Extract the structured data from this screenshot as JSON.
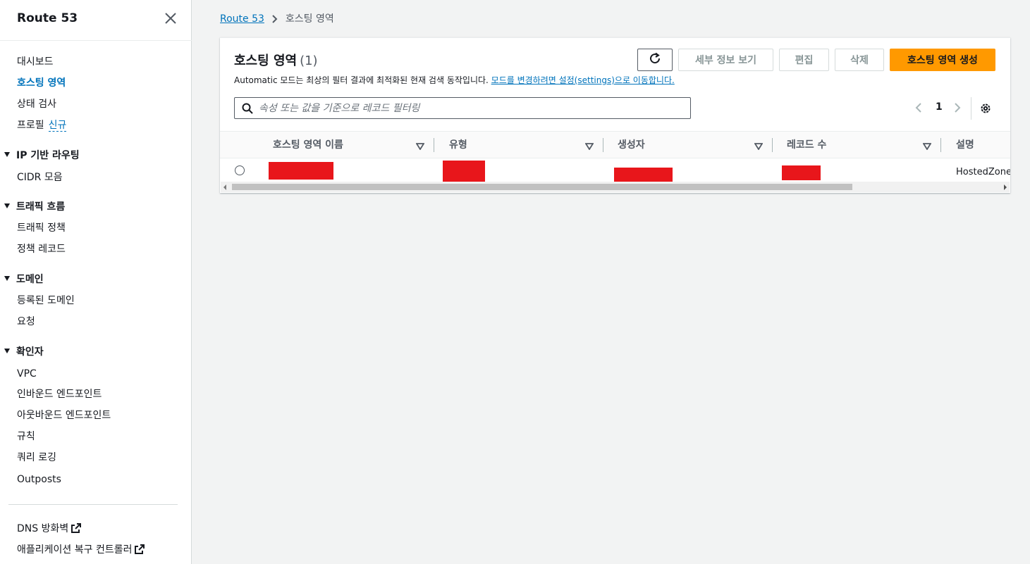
{
  "sidebar": {
    "title": "Route 53",
    "items": {
      "dashboard": "대시보드",
      "hosted_zones": "호스팅 영역",
      "health_checks": "상태 검사",
      "profiles": "프로필",
      "profiles_badge": "신규"
    },
    "sections": {
      "ip_routing": {
        "label": "IP 기반 라우팅",
        "items": [
          "CIDR 모음"
        ]
      },
      "traffic_flow": {
        "label": "트래픽 흐름",
        "items": [
          "트래픽 정책",
          "정책 레코드"
        ]
      },
      "domains": {
        "label": "도메인",
        "items": [
          "등록된 도메인",
          "요청"
        ]
      },
      "resolver": {
        "label": "확인자",
        "items": [
          "VPC",
          "인바운드 엔드포인트",
          "아웃바운드 엔드포인트",
          "규칙",
          "쿼리 로깅",
          "Outposts"
        ]
      }
    },
    "external": [
      "DNS 방화벽",
      "애플리케이션 복구 컨트롤러"
    ]
  },
  "breadcrumb": {
    "root": "Route 53",
    "current": "호스팅 영역"
  },
  "panel": {
    "title": "호스팅 영역",
    "count": "(1)",
    "desc_prefix": "Automatic 모드는 최상의 필터 결과에 최적화된 현재 검색 동작입니다. ",
    "desc_link": "모드를 변경하려면 설정(settings)으로 이동합니다.",
    "buttons": {
      "details": "세부 정보 보기",
      "edit": "편집",
      "delete": "삭제",
      "create": "호스팅 영역 생성"
    },
    "search_placeholder": "속성 또는 값을 기준으로 레코드 필터링",
    "page": "1",
    "columns": [
      "호스팅 영역 이름",
      "유형",
      "생성자",
      "레코드 수",
      "설명"
    ],
    "rows": [
      {
        "description": "HostedZone"
      }
    ]
  },
  "colors": {
    "accent": "#ff9900",
    "link": "#0073bb",
    "redaction": "#e8161b"
  }
}
